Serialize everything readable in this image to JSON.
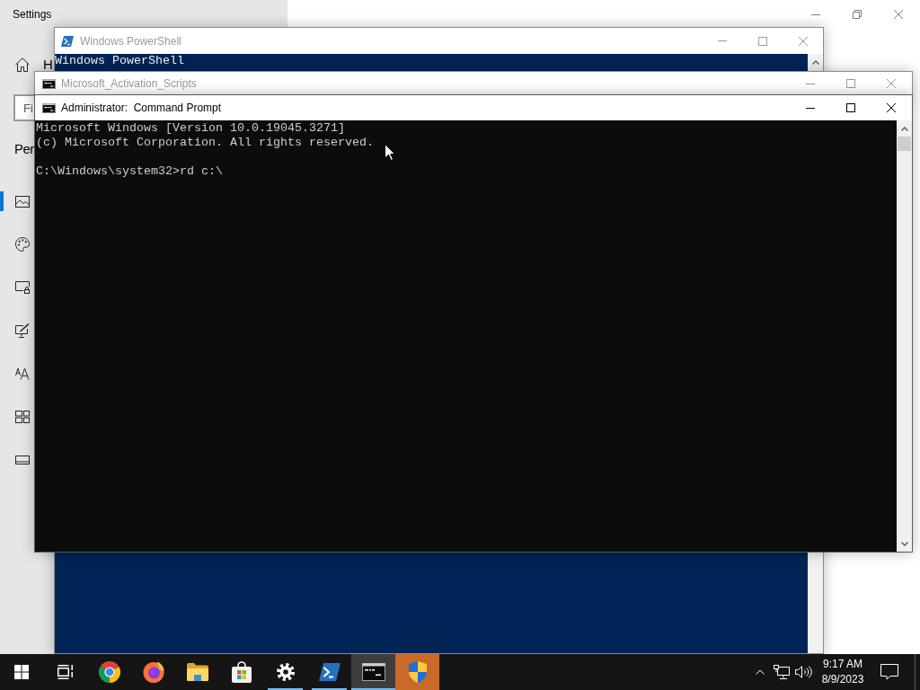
{
  "settings_window": {
    "title": "Settings",
    "home_link": "H",
    "search": {
      "placeholder": "Fi"
    },
    "section_heading": "Per",
    "nav_items": [
      {
        "kind": "picture",
        "selected": true
      },
      {
        "kind": "palette",
        "selected": false
      },
      {
        "kind": "lock-screen",
        "selected": false
      },
      {
        "kind": "themes",
        "selected": false
      },
      {
        "kind": "fonts",
        "selected": false
      },
      {
        "kind": "start",
        "selected": false
      },
      {
        "kind": "taskbar",
        "selected": false
      }
    ]
  },
  "powershell_window": {
    "title": "Windows PowerShell",
    "active": false,
    "console_lines": [
      "Windows PowerShell"
    ]
  },
  "activation_window": {
    "title": "Microsoft_Activation_Scripts",
    "active": false
  },
  "command_prompt_window": {
    "title": "Administrator:  Command Prompt",
    "active": true,
    "output_lines": [
      "Microsoft Windows [Version 10.0.19045.3271]",
      "(c) Microsoft Corporation. All rights reserved."
    ],
    "prompt": "C:\\Windows\\system32>rd c:\\"
  },
  "taskbar": {
    "apps": [
      {
        "kind": "chrome",
        "running": false,
        "selected": false,
        "attention": false
      },
      {
        "kind": "firefox",
        "running": false,
        "selected": false,
        "attention": false
      },
      {
        "kind": "file-explorer",
        "running": false,
        "selected": false,
        "attention": false
      },
      {
        "kind": "store",
        "running": false,
        "selected": false,
        "attention": false
      },
      {
        "kind": "settings",
        "running": true,
        "selected": false,
        "attention": false
      },
      {
        "kind": "powershell",
        "running": true,
        "selected": false,
        "attention": false
      },
      {
        "kind": "command-prompt",
        "running": true,
        "selected": true,
        "attention": false
      },
      {
        "kind": "security-shield",
        "running": false,
        "selected": false,
        "attention": true
      }
    ],
    "clock": {
      "time": "9:17 AM",
      "date": "8/9/2023"
    }
  }
}
